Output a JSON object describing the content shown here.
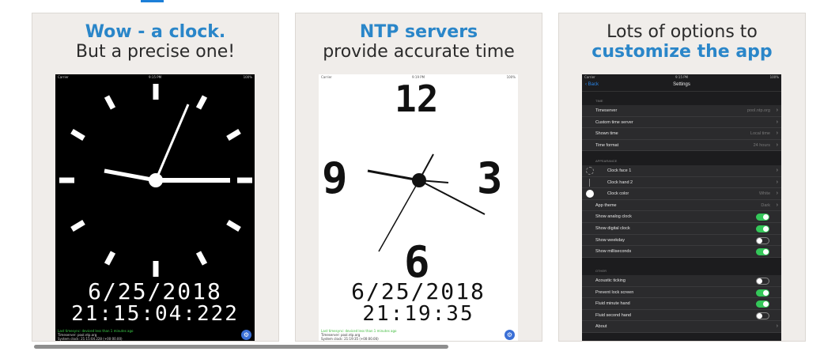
{
  "cards": [
    {
      "title_line1": "Wow - a clock.",
      "title_line2": "But a precise one!"
    },
    {
      "title_line1": "NTP servers",
      "title_line2": "provide accurate time"
    },
    {
      "title_line1": "Lots of options to",
      "title_line2": "customize the app"
    }
  ],
  "status": {
    "carrier": "Carrier",
    "time": "9:15 PM",
    "time2": "9:19 PM",
    "battery": "100%"
  },
  "screen1": {
    "date": "6/25/2018",
    "time": "21:15:04:222",
    "foot_green": "Last timesync: deviced less than 1 minutes ago",
    "foot_line2": "Timeserver: pool.ntp.org",
    "foot_line3": "System clock: 21:15:04.228 (+00:00.00)"
  },
  "screen2": {
    "numerals": {
      "n12": "12",
      "n3": "3",
      "n6": "6",
      "n9": "9"
    },
    "date": "6/25/2018",
    "time": "21:19:35",
    "foot_green": "Last timesync: deviced less than 1 minutes ago",
    "foot_line2": "Timeserver: pool.ntp.org",
    "foot_line3": "System clock: 21:19:35 (+00:00.00)"
  },
  "settings": {
    "back": "Back",
    "title": "Settings",
    "section_time": "TIME",
    "section_appearance": "APPEARANCE",
    "section_other": "OTHER",
    "rows_time": [
      {
        "label": "Timeserver",
        "value": "pool.ntp.org"
      },
      {
        "label": "Custom time server",
        "value": ""
      },
      {
        "label": "Shown time",
        "value": "Local time"
      },
      {
        "label": "Time format",
        "value": "24 hours"
      }
    ],
    "rows_appearance": [
      {
        "label": "Clock face 1",
        "value": ""
      },
      {
        "label": "Clock hand 2",
        "value": ""
      },
      {
        "label": "Clock color",
        "value": "White"
      },
      {
        "label": "App theme",
        "value": "Dark"
      },
      {
        "label": "Show analog clock",
        "toggle": true
      },
      {
        "label": "Show digital clock",
        "toggle": true
      },
      {
        "label": "Show weekday",
        "toggle": false
      },
      {
        "label": "Show milliseconds",
        "toggle": true
      }
    ],
    "rows_other": [
      {
        "label": "Acoustic ticking",
        "toggle": false
      },
      {
        "label": "Prevent lock screen",
        "toggle": true
      },
      {
        "label": "Fluid minute hand",
        "toggle": true
      },
      {
        "label": "Fluid second hand",
        "toggle": false
      },
      {
        "label": "About",
        "value": ""
      }
    ]
  },
  "colors": {
    "accent": "#2a86c9",
    "toggle_on": "#34c759"
  }
}
